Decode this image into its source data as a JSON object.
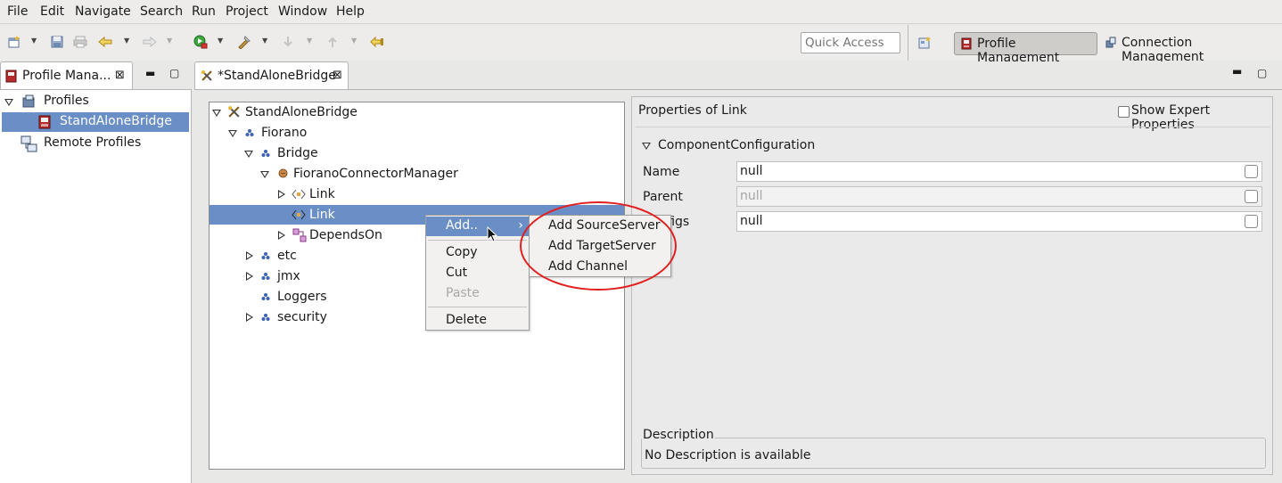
{
  "menubar": {
    "items": [
      "File",
      "Edit",
      "Navigate",
      "Search",
      "Run",
      "Project",
      "Window",
      "Help"
    ]
  },
  "toolbar": {
    "quick_access_placeholder": "Quick Access",
    "perspectives": {
      "profile_management": "Profile Management",
      "connection_management": "Connection Management"
    }
  },
  "left_view": {
    "tab_title": "Profile Mana...",
    "tree": {
      "profiles": "Profiles",
      "standalone_bridge": "StandAloneBridge",
      "remote_profiles": "Remote Profiles"
    }
  },
  "editor": {
    "tab_title": "*StandAloneBridge",
    "tree": {
      "root": "StandAloneBridge",
      "fiorano": "Fiorano",
      "bridge": "Bridge",
      "connector_manager": "FioranoConnectorManager",
      "link1": "Link",
      "link2": "Link",
      "depends_on": "DependsOn",
      "etc": "etc",
      "jmx": "jmx",
      "loggers": "Loggers",
      "security": "security"
    },
    "context_menu": {
      "add": "Add..",
      "copy": "Copy",
      "cut": "Cut",
      "paste": "Paste",
      "delete": "Delete"
    },
    "submenu": {
      "add_source_server": "Add SourceServer",
      "add_target_server": "Add TargetServer",
      "add_channel": "Add Channel"
    }
  },
  "properties": {
    "title": "Properties of Link",
    "show_expert": "Show Expert Properties",
    "section": "ComponentConfiguration",
    "rows": [
      {
        "label": "Name",
        "value": "null"
      },
      {
        "label": "Parent",
        "value": "null"
      },
      {
        "label": "Configs",
        "value": "null"
      }
    ],
    "description_title": "Description",
    "description_text": "No Description is available"
  }
}
